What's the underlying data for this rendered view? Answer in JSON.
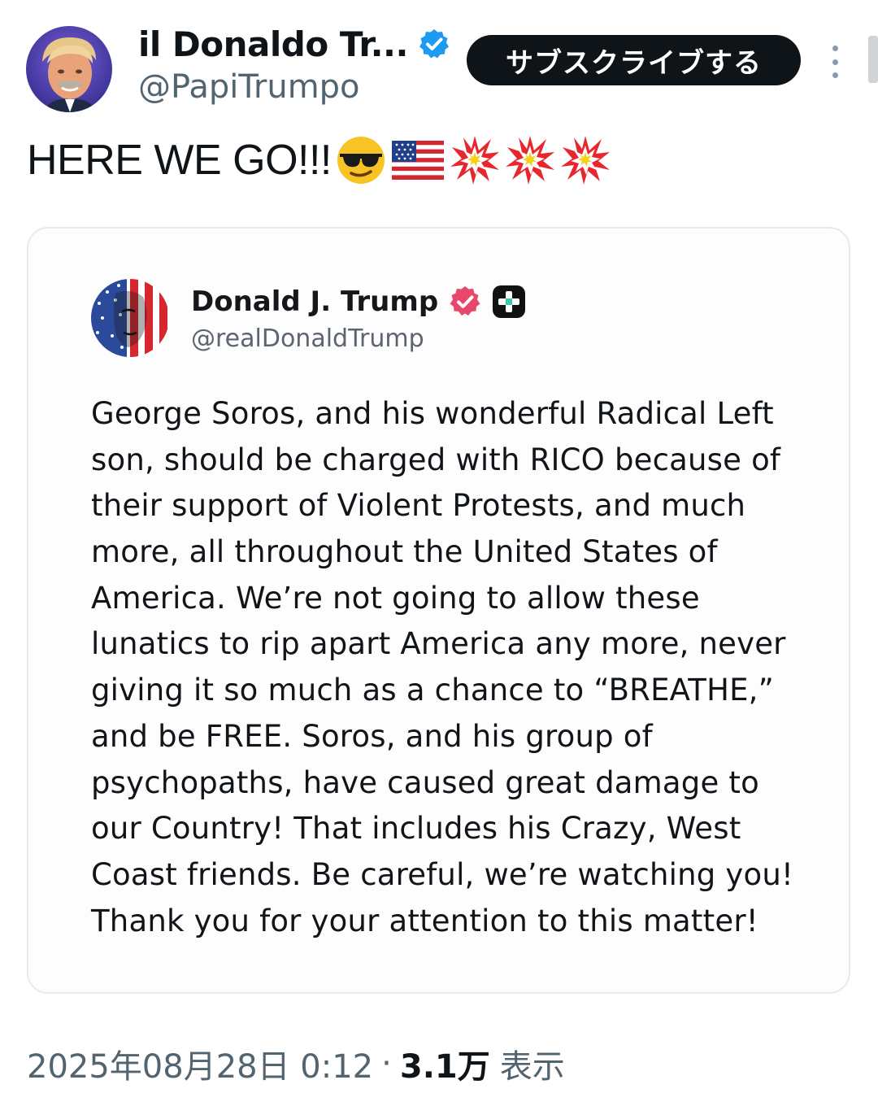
{
  "post": {
    "author": {
      "display_name": "il Donaldo Tr...",
      "handle": "@PapiTrumpo"
    },
    "subscribe_label": "サブスクライブする",
    "text": "HERE WE GO!!!",
    "emojis": [
      "sunglasses-face",
      "us-flag",
      "collision",
      "collision",
      "collision"
    ],
    "timestamp": "2025年08月28日 0:12",
    "separator": "·",
    "views_count": "3.1万",
    "views_label": "表示"
  },
  "quoted": {
    "author": {
      "display_name": "Donald J. Trump",
      "handle": "@realDonaldTrump"
    },
    "lines": [
      "George Soros, and his wonderful Radical Left",
      "son, should be charged with RICO because of",
      "their support of Violent Protests, and much",
      "more, all throughout the United States of",
      "America. We’re not going to allow these",
      "lunatics to rip apart America any more, never",
      "giving it so much as a chance to “BREATHE,”",
      "and be FREE. Soros, and his group of",
      "psychopaths, have caused great damage to",
      "our Country! That includes his Crazy, West",
      "Coast friends. Be careful, we’re watching you!",
      "Thank you for your attention to this matter!"
    ]
  },
  "colors": {
    "text_primary": "#0f1419",
    "text_secondary": "#536471",
    "verified_blue": "#1d9bf0",
    "truth_badge_pink": "#e8476b",
    "subscribe_bg": "#0f1419",
    "card_border": "#e8eaec"
  }
}
